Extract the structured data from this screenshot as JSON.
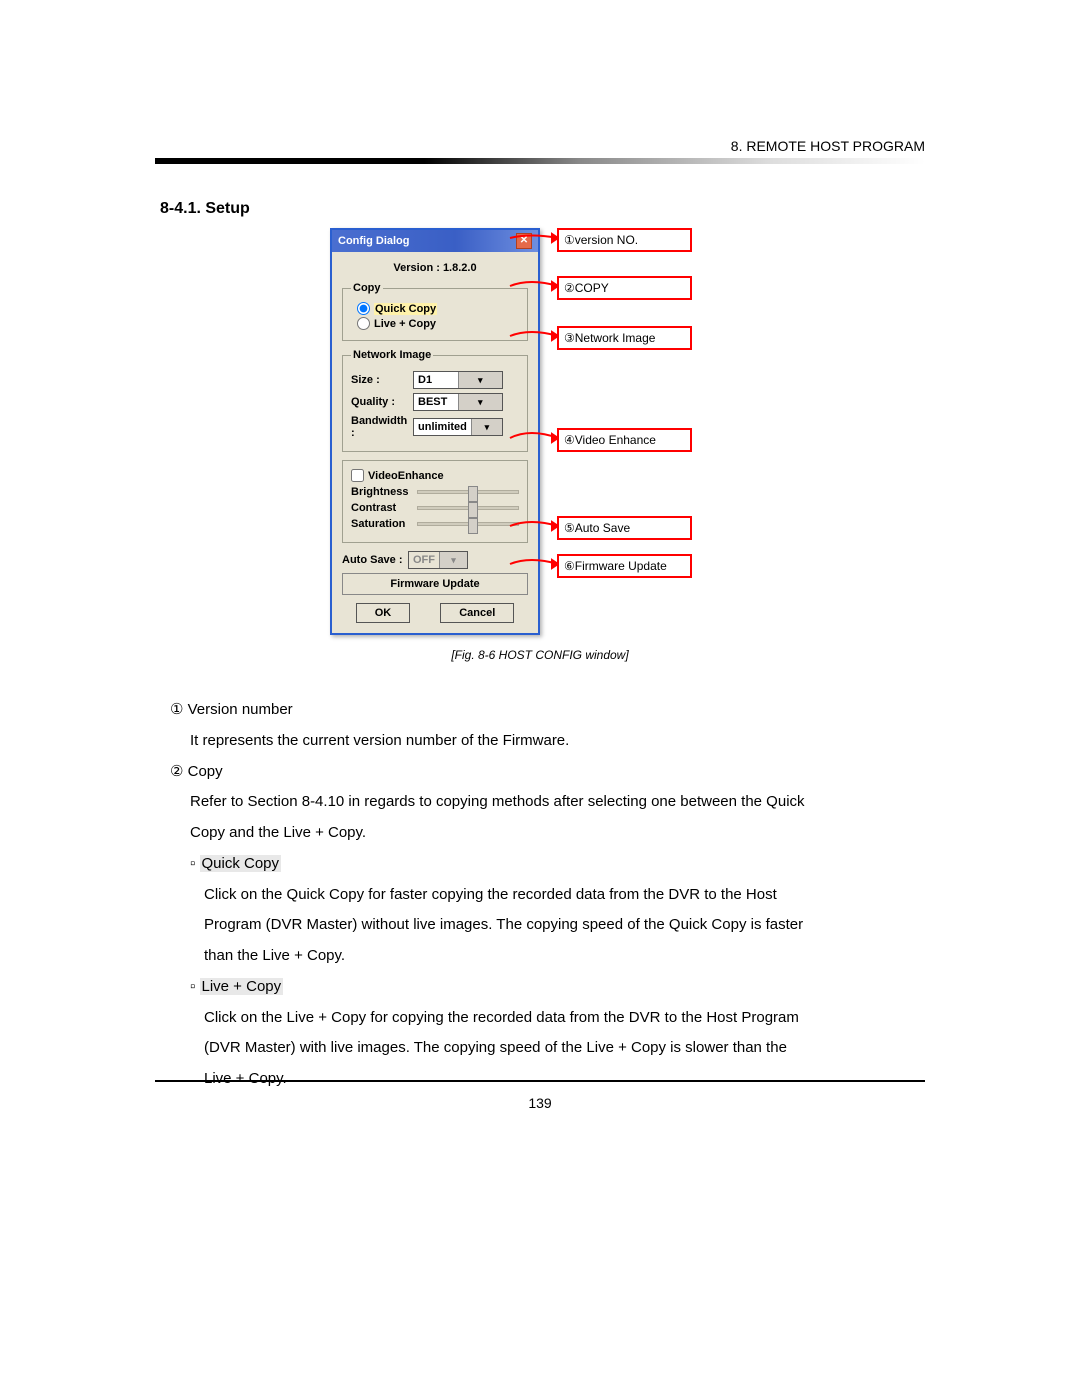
{
  "header": {
    "chapter": "8. REMOTE HOST PROGRAM"
  },
  "section": {
    "title": "8-4.1. Setup"
  },
  "dialog": {
    "title": "Config Dialog",
    "close_glyph": "✕",
    "version_label": "Version  : 1.8.2.0",
    "copy": {
      "legend": "Copy",
      "quick": "Quick Copy",
      "live": "Live + Copy"
    },
    "net": {
      "legend": "Network Image",
      "size_label": "Size  :",
      "size_value": "D1",
      "quality_label": "Quality :",
      "quality_value": "BEST",
      "bw_label": "Bandwidth :",
      "bw_value": "unlimited"
    },
    "enhance": {
      "check": "VideoEnhance",
      "brightness": "Brightness",
      "contrast": "Contrast",
      "saturation": "Saturation"
    },
    "autosave": {
      "label": "Auto Save :",
      "value": "OFF"
    },
    "firmware": "Firmware Update",
    "ok": "OK",
    "cancel": "Cancel"
  },
  "callouts": {
    "c1": "①version NO.",
    "c2": "②COPY",
    "c3": "③Network Image",
    "c4": "④Video Enhance",
    "c5": "⑤Auto Save",
    "c6": "⑥Firmware Update"
  },
  "caption": "[Fig. 8-6 HOST CONFIG window]",
  "body": {
    "i1_title": "①  Version number",
    "i1_text": "It represents the current version number of the Firmware.",
    "i2_title": "②  Copy",
    "i2_text1": "Refer to Section 8-4.10 in regards to copying methods after selecting one between the Quick",
    "i2_text2": "Copy and the Live + Copy.",
    "qc_label": "▫ ",
    "qc_hl": "Quick Copy",
    "qc_l1": "Click on the Quick Copy for faster copying the recorded data from the DVR to the Host",
    "qc_l2": "Program (DVR Master) without live images. The copying speed of the Quick Copy is faster",
    "qc_l3": "than the Live + Copy.",
    "lc_label": "▫ ",
    "lc_hl": "Live + Copy",
    "lc_l1": "Click on the Live + Copy for copying the recorded data from the DVR to the Host Program",
    "lc_l2": "(DVR Master) with live images. The copying speed of the Live + Copy is slower than the",
    "lc_l3": "Live + Copy."
  },
  "page_number": "139",
  "arrow_glyph": "▾"
}
